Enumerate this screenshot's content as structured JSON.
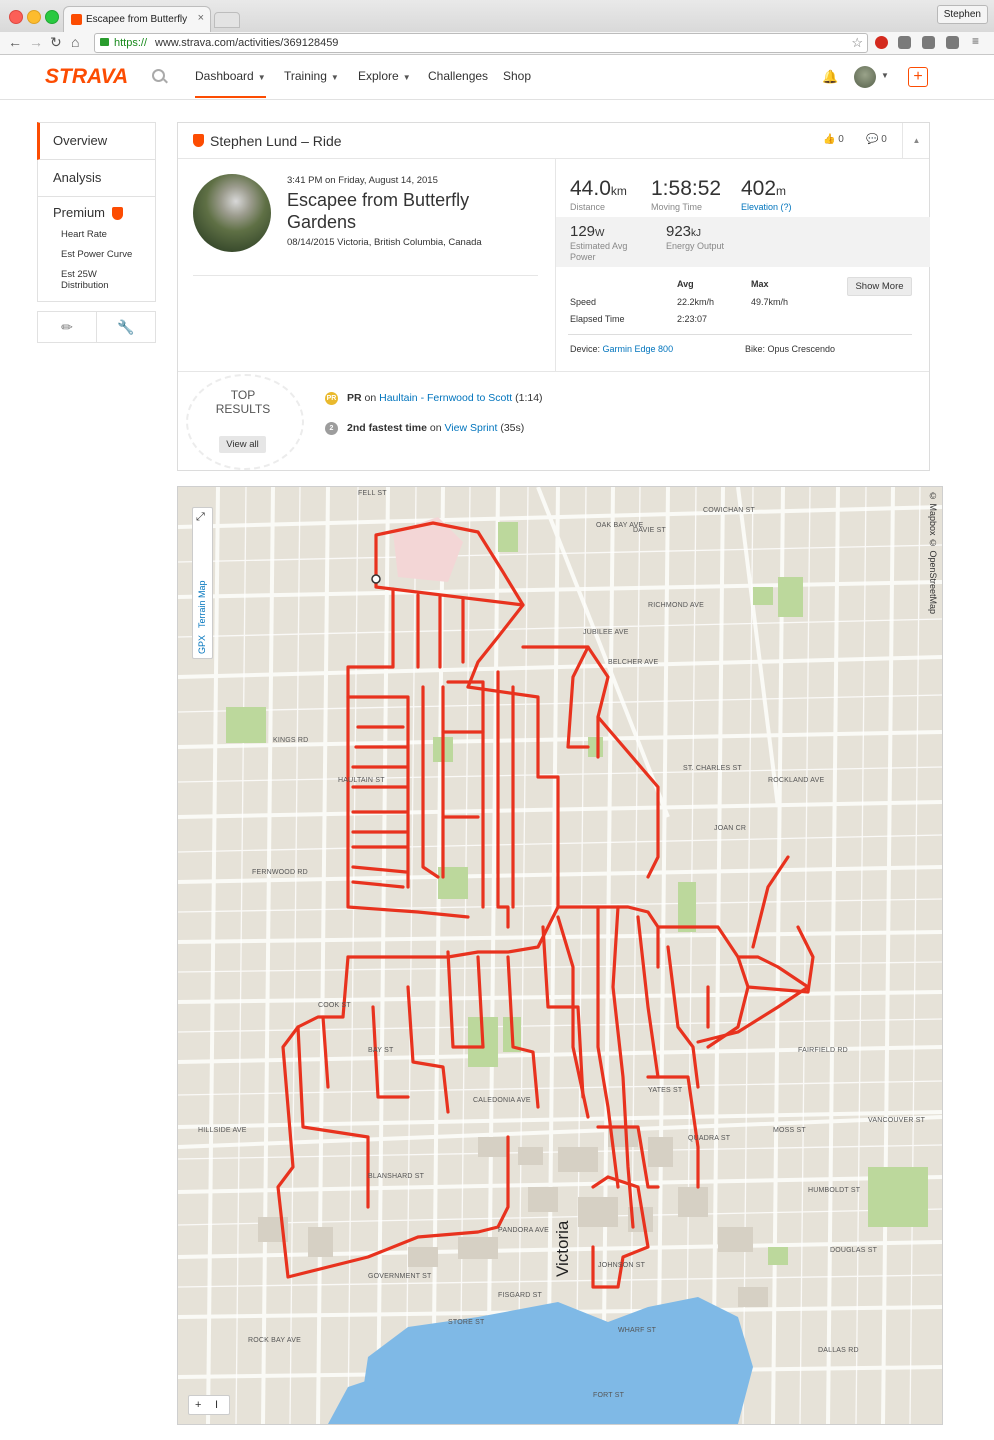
{
  "browser": {
    "tab_title": "Escapee from Butterfly Ga",
    "tab_close": "×",
    "url_https": "https://",
    "url_rest": "www.strava.com/activities/369128459",
    "profile_name": "Stephen"
  },
  "header": {
    "logo": "STRAVA",
    "nav": [
      "Dashboard",
      "Training",
      "Explore",
      "Challenges",
      "Shop"
    ],
    "plus": "+"
  },
  "sidebar": {
    "overview": "Overview",
    "analysis": "Analysis",
    "premium": "Premium",
    "premium_items": [
      "Heart Rate",
      "Est Power Curve",
      "Est 25W Distribution"
    ]
  },
  "activity": {
    "athlete_title": "Stephen Lund – Ride",
    "kudos_count": "0",
    "comment_count": "0",
    "date_time": "3:41 PM on Friday, August 14, 2015",
    "name": "Escapee from Butterfly Gardens",
    "location": "08/14/2015 Victoria, British Columbia, Canada",
    "distance": {
      "value": "44.0",
      "unit": "km",
      "label": "Distance"
    },
    "moving_time": {
      "value": "1:58:52",
      "label": "Moving Time"
    },
    "elevation": {
      "value": "402",
      "unit": "m",
      "label": "Elevation (?)"
    },
    "power": {
      "value": "129",
      "unit": "W",
      "label": "Estimated Avg Power"
    },
    "energy": {
      "value": "923",
      "unit": "kJ",
      "label": "Energy Output"
    },
    "table": {
      "col_avg": "Avg",
      "col_max": "Max",
      "speed_label": "Speed",
      "speed_avg": "22.2km/h",
      "speed_max": "49.7km/h",
      "elapsed_label": "Elapsed Time",
      "elapsed_avg": "2:23:07"
    },
    "show_more": "Show More",
    "device_label": "Device:",
    "device_value": "Garmin Edge 800",
    "bike": "Bike: Opus Crescendo"
  },
  "results": {
    "title_line1": "TOP",
    "title_line2": "RESULTS",
    "view_all": "View all",
    "pr_medal": "PR",
    "pr_prefix": "PR",
    "pr_on": "on",
    "pr_segment": "Haultain - Fernwood to Scott",
    "pr_time": "(1:14)",
    "second_medal": "2",
    "second_prefix": "2nd fastest time",
    "second_on": "on",
    "second_segment": "View Sprint",
    "second_time": "(35s)"
  },
  "map": {
    "terrain_label": "Terrain Map",
    "gpx_label": "GPX",
    "zoom_in": "+",
    "zoom_out": "I",
    "attribution": "© Mapbox © OpenStreetMap",
    "city": "Victoria",
    "streets": [
      "FELL ST",
      "JUBILEE AVE",
      "RICHMOND AVE",
      "BELCHER AVE",
      "ST. CHARLES ST",
      "JOAN CR",
      "FERNWOOD RD",
      "COOK ST",
      "YATES ST",
      "QUADRA ST",
      "BLANSHARD ST",
      "GOVERNMENT ST",
      "DOUGLAS ST",
      "DALLAS RD",
      "FORT ST",
      "PANDORA AVE",
      "JOHNSON ST",
      "FISGARD ST",
      "HILLSIDE AVE",
      "BAY ST",
      "CALEDONIA AVE",
      "ROCKLAND AVE",
      "OAK BAY AVE",
      "MOSS ST",
      "COWICHAN ST",
      "DAVIE ST",
      "HAULTAIN ST",
      "KINGS RD",
      "ROCK BAY AVE",
      "WHARF ST",
      "STORE ST",
      "VANCOUVER ST",
      "HUMBOLDT ST",
      "FAIRFIELD RD"
    ]
  },
  "colors": {
    "accent": "#fc4c02",
    "link": "#0074bd",
    "route": "#e8321e",
    "water": "#7fb9e6",
    "park": "#bcd89c"
  }
}
